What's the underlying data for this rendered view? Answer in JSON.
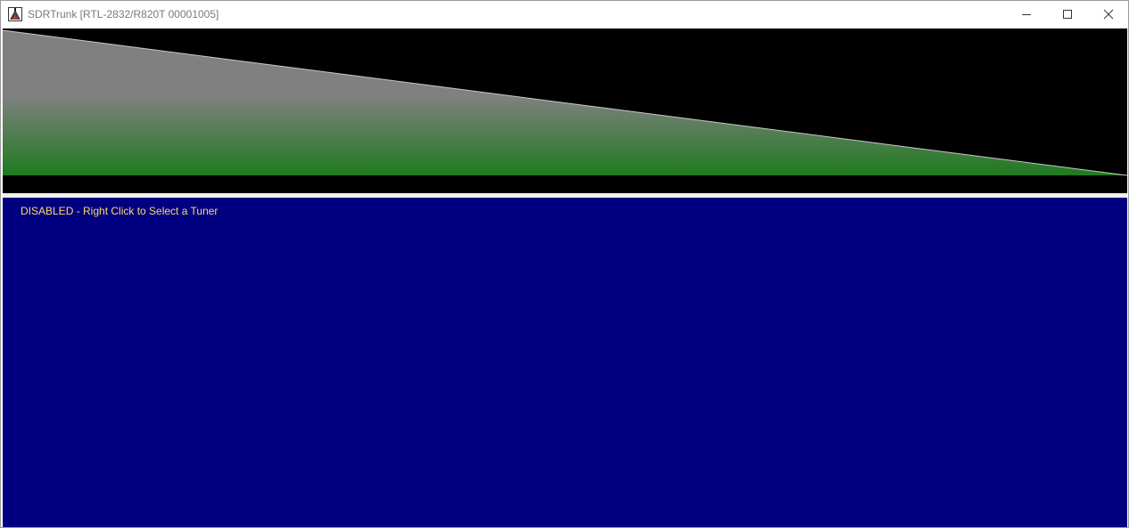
{
  "window": {
    "title": "SDRTrunk [RTL-2832/R820T 00001005]",
    "icon": "sdrtrunk-app-icon",
    "controls": {
      "minimize_icon": "minimize-icon",
      "maximize_icon": "maximize-icon",
      "close_icon": "close-icon"
    }
  },
  "spectrum": {
    "background_color": "#000000",
    "fill_top_color": "#808080",
    "fill_bottom_color": "#1f7a1f",
    "line_color": "#c8c8c8"
  },
  "waterfall": {
    "background_color": "#000080",
    "status_message": "DISABLED - Right Click to Select a Tuner",
    "status_color": "#ffd966"
  }
}
